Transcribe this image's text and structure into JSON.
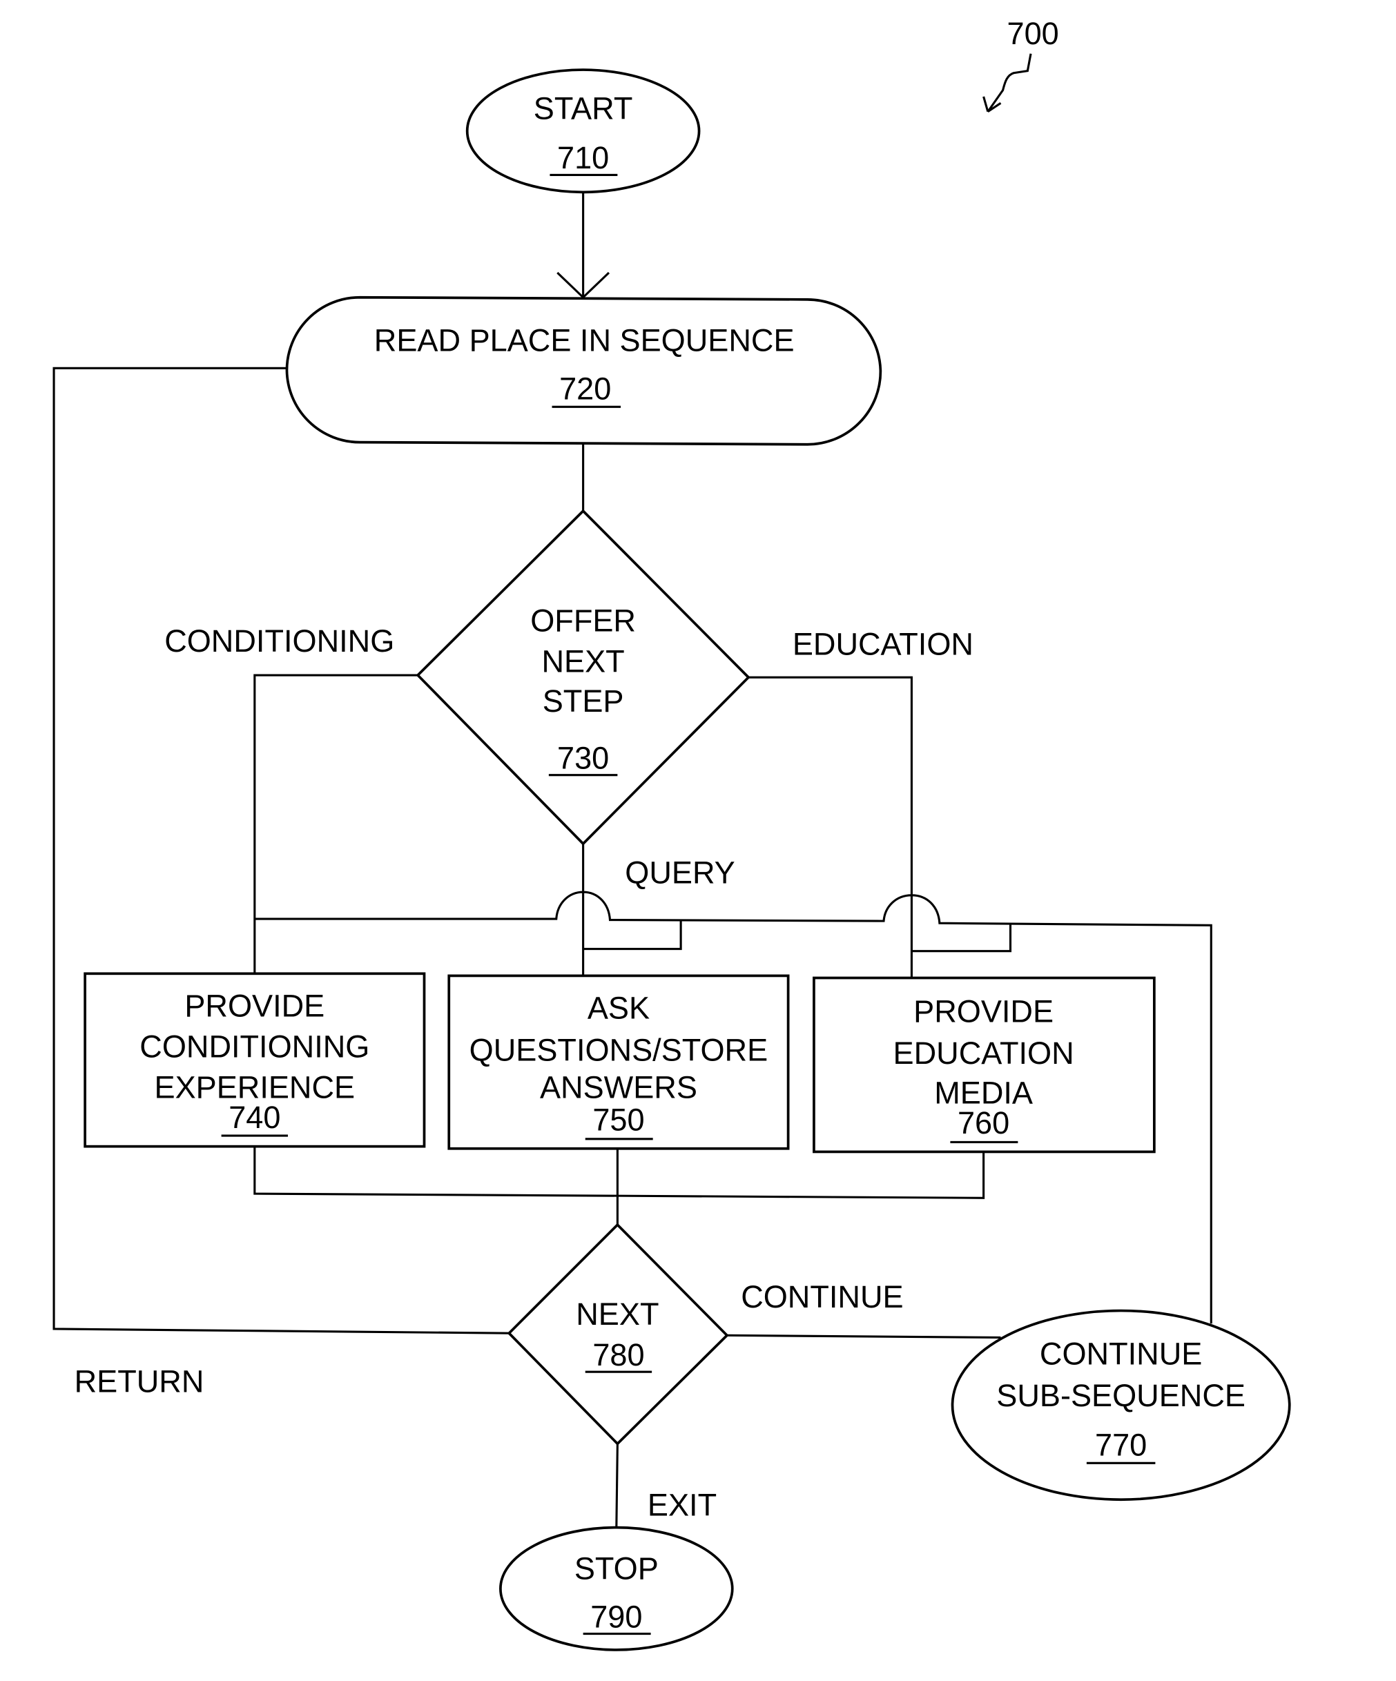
{
  "figure": {
    "reference_number": "700"
  },
  "nodes": {
    "start": {
      "label": "START",
      "number": "710"
    },
    "read_place": {
      "label": "READ PLACE IN SEQUENCE",
      "number": "720"
    },
    "offer_next_step": {
      "lines": [
        "OFFER",
        "NEXT",
        "STEP"
      ],
      "number": "730"
    },
    "provide_conditioning": {
      "lines": [
        "PROVIDE",
        "CONDITIONING",
        "EXPERIENCE"
      ],
      "number": "740"
    },
    "ask_questions": {
      "lines": [
        "ASK",
        "QUESTIONS/STORE",
        "ANSWERS"
      ],
      "number": "750"
    },
    "provide_education": {
      "lines": [
        "PROVIDE",
        "EDUCATION",
        "MEDIA"
      ],
      "number": "760"
    },
    "continue_sub_sequence": {
      "lines": [
        "CONTINUE",
        "SUB-SEQUENCE"
      ],
      "number": "770"
    },
    "next": {
      "label": "NEXT",
      "number": "780"
    },
    "stop": {
      "label": "STOP",
      "number": "790"
    }
  },
  "edge_labels": {
    "conditioning": "CONDITIONING",
    "education": "EDUCATION",
    "query": "QUERY",
    "continue": "CONTINUE",
    "return": "RETURN",
    "exit": "EXIT"
  }
}
